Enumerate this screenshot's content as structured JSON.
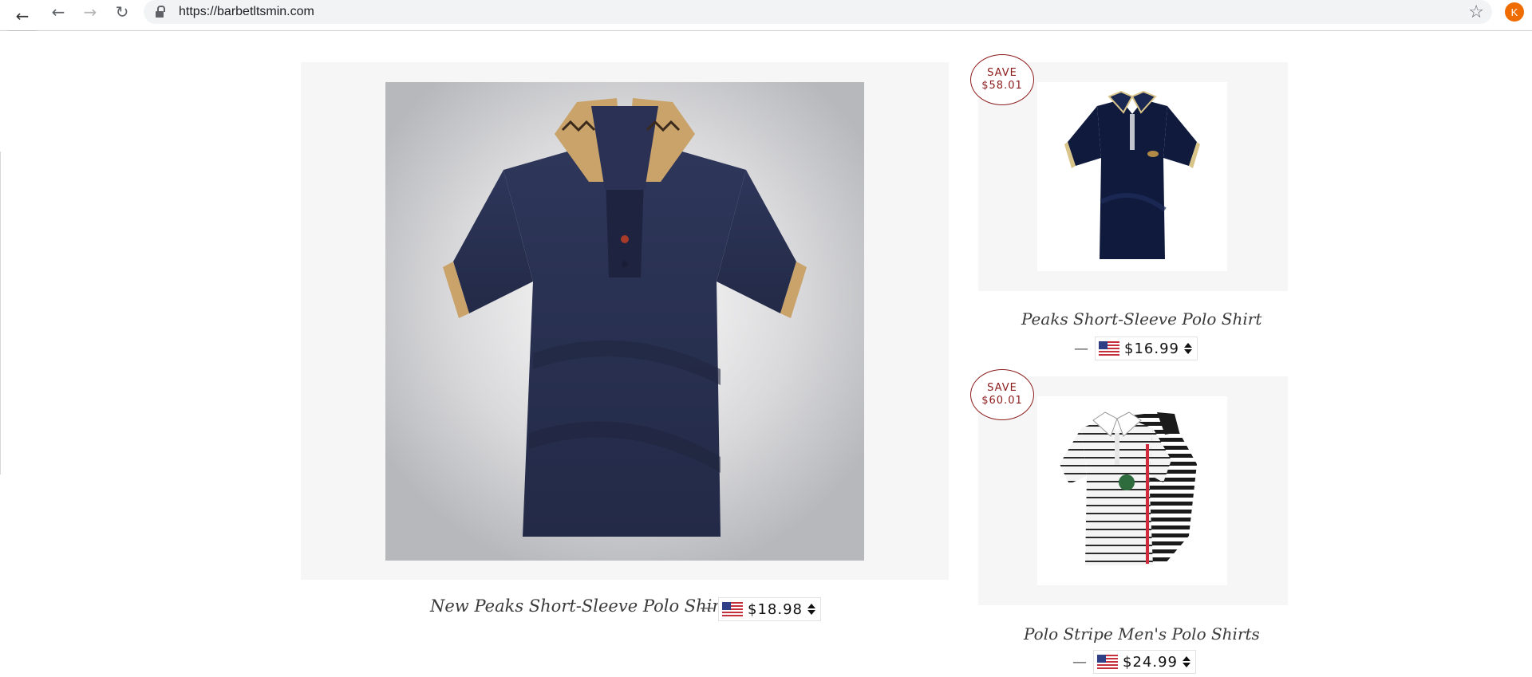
{
  "browser": {
    "url": "https://barbetltsmin.com",
    "profile_initial": "K",
    "icons": {
      "back": "back-arrow-icon",
      "forward": "forward-arrow-icon",
      "reload": "reload-icon",
      "lock": "lock-icon",
      "bookmark": "star-icon"
    }
  },
  "products": [
    {
      "title": "New Peaks Short-Sleeve Polo Shirt",
      "price": "$18.98",
      "currency_flag": "us-flag-icon",
      "description": "navy polo shirt with gold greek-key collar"
    },
    {
      "title": "Peaks Short-Sleeve Polo Shirt",
      "price": "$16.99",
      "save_label": "SAVE",
      "save_amount": "$58.01",
      "currency_flag": "us-flag-icon",
      "description": "navy polo shirt with striped collar"
    },
    {
      "title": "Polo Stripe Men's Polo Shirts",
      "price": "$24.99",
      "save_label": "SAVE",
      "save_amount": "$60.01",
      "currency_flag": "us-flag-icon",
      "description": "striped white polo shirts"
    }
  ],
  "separator": "—",
  "colors": {
    "accent_red": "#8c1b1b",
    "frame_bg": "#f6f6f6",
    "navy": "#2a3457"
  }
}
